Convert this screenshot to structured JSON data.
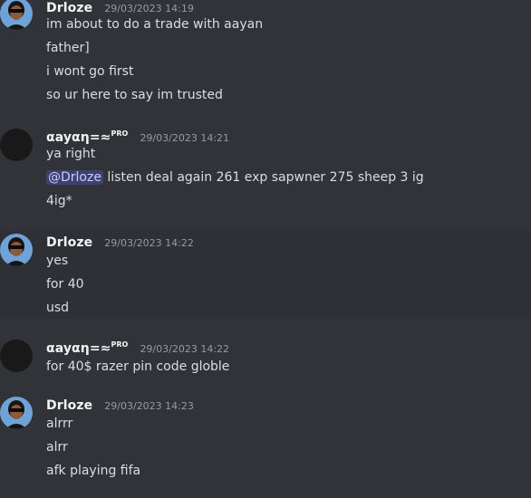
{
  "messages": [
    {
      "author": "Drloze",
      "badge": "",
      "timestamp": "29/03/2023 14:19",
      "lines": [
        "im about to do a trade with aayan",
        "father]",
        "i wont go first",
        "so ur here to say im trusted"
      ]
    },
    {
      "author": "αayαη=≈",
      "badge": "PRO",
      "timestamp": "29/03/2023 14:21",
      "lines": [
        "ya right"
      ],
      "mention": {
        "label": "@Drloze",
        "text": " listen deal again 261 exp sapwner 275 sheep 3 ig"
      },
      "extra_lines": [
        "4ig*"
      ]
    },
    {
      "author": "Drloze",
      "badge": "",
      "timestamp": "29/03/2023 14:22",
      "lines": [
        "yes",
        "for 40",
        "usd"
      ]
    },
    {
      "author": "αayαη=≈",
      "badge": "PRO",
      "timestamp": "29/03/2023 14:22",
      "lines": [
        "for 40$ razer pin code globle"
      ]
    },
    {
      "author": "Drloze",
      "badge": "",
      "timestamp": "29/03/2023 14:23",
      "lines": [
        "alrrr",
        "alrr",
        "afk playing fifa"
      ]
    }
  ],
  "colors": {
    "background": "#313338",
    "highlight": "#2e3035",
    "text": "#dbdee1",
    "username": "#f2f3f5",
    "timestamp": "#949ba4",
    "mention_bg": "#3c4270",
    "mention_text": "#c9cdfb"
  },
  "icons": {
    "drloze_avatar": "avatar-sunglasses-man",
    "aayan_avatar": "avatar-dark-blank"
  }
}
